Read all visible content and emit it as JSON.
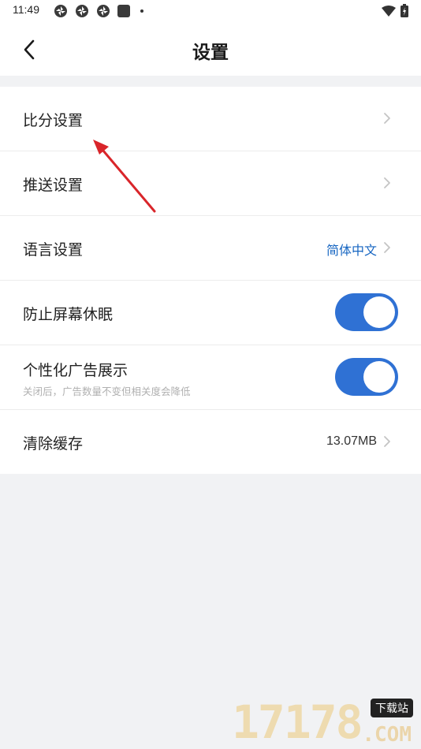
{
  "status_bar": {
    "time": "11:49"
  },
  "header": {
    "title": "设置"
  },
  "settings": [
    {
      "label": "比分设置",
      "value": "",
      "kind": "chevron"
    },
    {
      "label": "推送设置",
      "value": "",
      "kind": "chevron"
    },
    {
      "label": "语言设置",
      "value": "简体中文",
      "kind": "chevron"
    },
    {
      "label": "防止屏幕休眠",
      "enabled": true,
      "kind": "toggle"
    },
    {
      "label": "个性化广告展示",
      "sub": "关闭后，广告数量不变但相关度会降低",
      "enabled": true,
      "kind": "toggle"
    },
    {
      "label": "清除缓存",
      "value": "13.07MB",
      "kind": "chevron"
    }
  ],
  "watermark": {
    "digits": "17178",
    "badge": "下载站",
    "suffix": ".COM"
  },
  "colors": {
    "accent": "#2f71d4",
    "value_blue": "#1766c2",
    "annotation_red": "#d9252a",
    "background": "#f1f2f4"
  }
}
